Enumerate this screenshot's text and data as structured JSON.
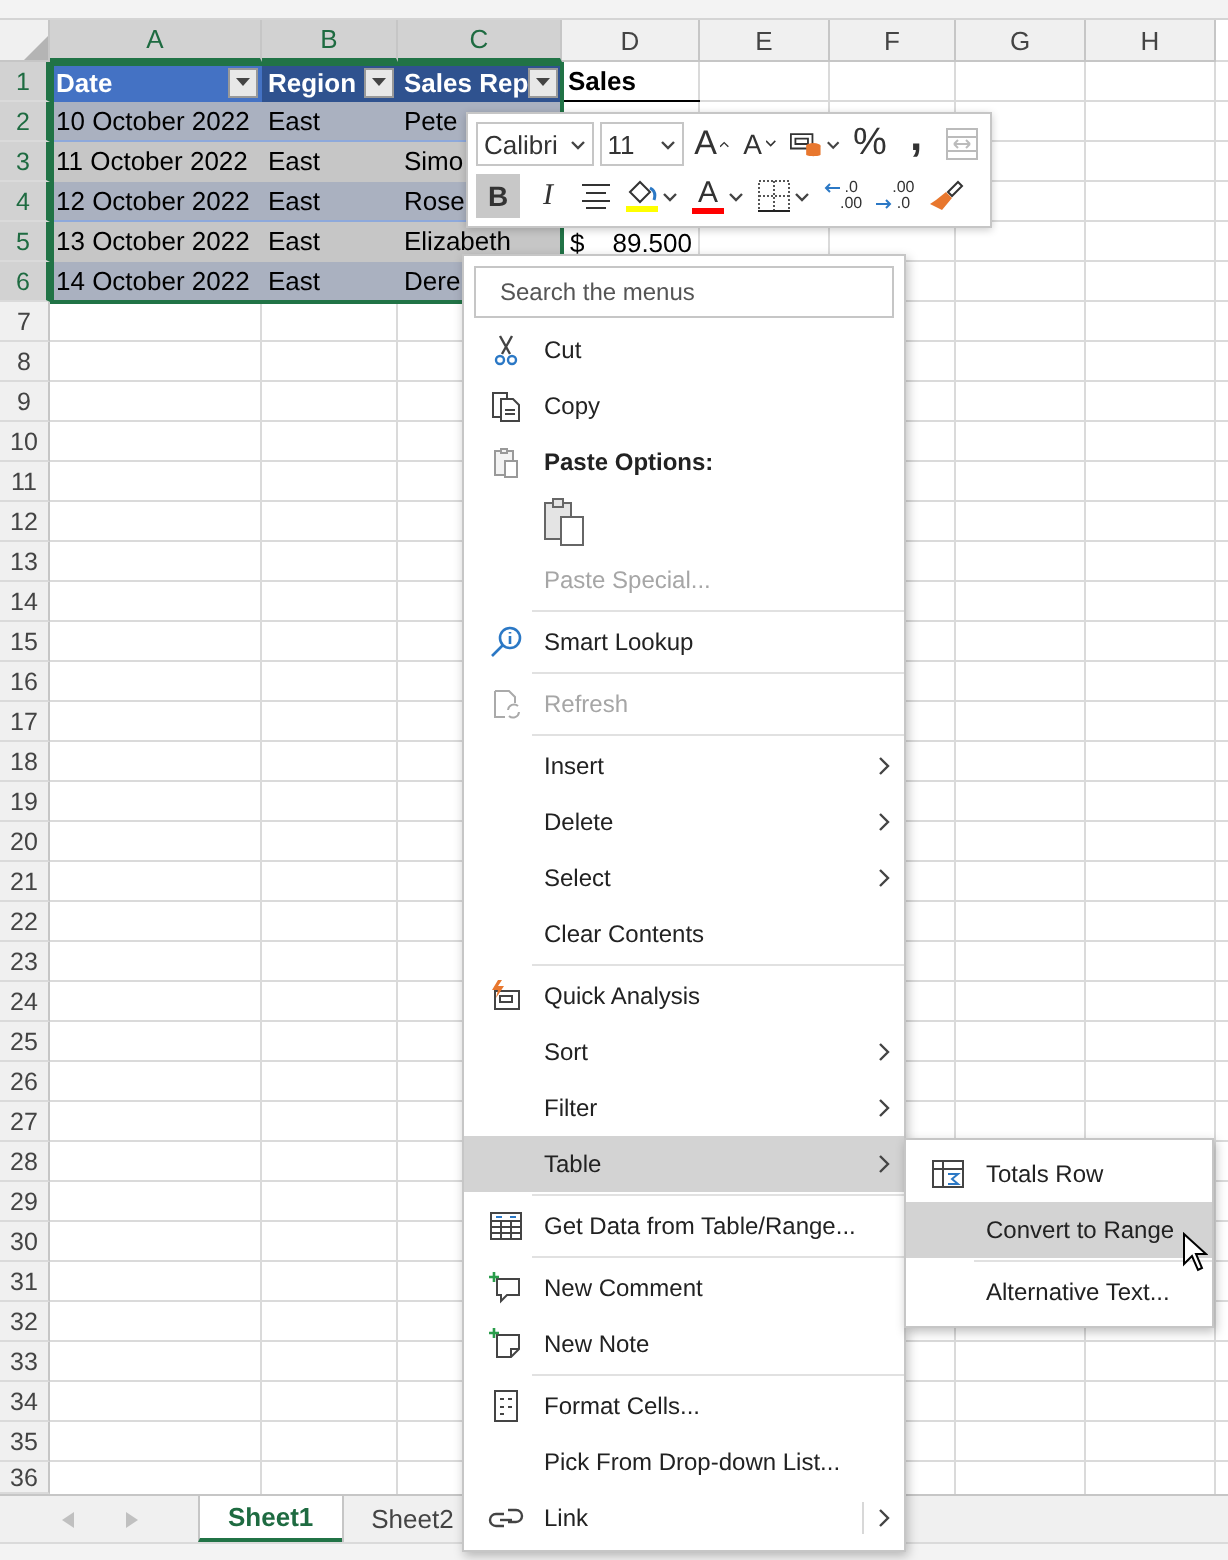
{
  "sheet": {
    "columns": [
      {
        "label": "A",
        "selected": true
      },
      {
        "label": "B",
        "selected": true
      },
      {
        "label": "C",
        "selected": true
      },
      {
        "label": "D",
        "selected": false
      },
      {
        "label": "E",
        "selected": false
      },
      {
        "label": "F",
        "selected": false
      },
      {
        "label": "G",
        "selected": false
      },
      {
        "label": "H",
        "selected": false
      }
    ],
    "row_numbers": [
      {
        "label": "1",
        "selected": true
      },
      {
        "label": "2",
        "selected": true
      },
      {
        "label": "3",
        "selected": true
      },
      {
        "label": "4",
        "selected": true
      },
      {
        "label": "5",
        "selected": true
      },
      {
        "label": "6",
        "selected": true
      },
      {
        "label": "7",
        "selected": false
      },
      {
        "label": "8",
        "selected": false
      },
      {
        "label": "9",
        "selected": false
      },
      {
        "label": "10",
        "selected": false
      },
      {
        "label": "11",
        "selected": false
      },
      {
        "label": "12",
        "selected": false
      },
      {
        "label": "13",
        "selected": false
      },
      {
        "label": "14",
        "selected": false
      },
      {
        "label": "15",
        "selected": false
      },
      {
        "label": "16",
        "selected": false
      },
      {
        "label": "17",
        "selected": false
      },
      {
        "label": "18",
        "selected": false
      },
      {
        "label": "19",
        "selected": false
      },
      {
        "label": "20",
        "selected": false
      },
      {
        "label": "21",
        "selected": false
      },
      {
        "label": "22",
        "selected": false
      },
      {
        "label": "23",
        "selected": false
      },
      {
        "label": "24",
        "selected": false
      },
      {
        "label": "25",
        "selected": false
      },
      {
        "label": "26",
        "selected": false
      },
      {
        "label": "27",
        "selected": false
      },
      {
        "label": "28",
        "selected": false
      },
      {
        "label": "29",
        "selected": false
      },
      {
        "label": "30",
        "selected": false
      },
      {
        "label": "31",
        "selected": false
      },
      {
        "label": "32",
        "selected": false
      },
      {
        "label": "33",
        "selected": false
      },
      {
        "label": "34",
        "selected": false
      },
      {
        "label": "35",
        "selected": false
      },
      {
        "label": "36",
        "selected": false
      }
    ],
    "table": {
      "selected": true,
      "headers": [
        {
          "label": "Date",
          "filter": true
        },
        {
          "label": "Region",
          "filter": true
        },
        {
          "label": "Sales Rep",
          "filter": true
        }
      ],
      "rows": [
        {
          "cells": [
            "10 October 2022",
            "East",
            "Pete"
          ]
        },
        {
          "cells": [
            "11 October 2022",
            "East",
            "Simo"
          ]
        },
        {
          "cells": [
            "12 October 2022",
            "East",
            "Rose"
          ]
        },
        {
          "cells": [
            "13 October 2022",
            "East",
            "Elizabeth"
          ],
          "sales": {
            "symbol": "$",
            "amount": "89.500"
          }
        },
        {
          "cells": [
            "14 October 2022",
            "East",
            "Dere"
          ]
        }
      ]
    },
    "column_d_header": "Sales"
  },
  "mini_toolbar": {
    "font": "Calibri",
    "size": "11",
    "row_1": [
      {
        "kind": "grow-font",
        "glyph": "A"
      },
      {
        "kind": "shrink-font",
        "glyph": "A"
      },
      {
        "kind": "cell-styles"
      },
      {
        "kind": "percent",
        "glyph": "%"
      },
      {
        "kind": "comma",
        "glyph": ","
      },
      {
        "kind": "merge",
        "disabled": true
      }
    ],
    "row_2": [
      {
        "kind": "bold",
        "glyph": "B",
        "selected": true
      },
      {
        "kind": "italic",
        "glyph": "I",
        "selected": false
      },
      {
        "kind": "center"
      },
      {
        "kind": "fill-color",
        "color": "#ffff00"
      },
      {
        "kind": "font-color",
        "glyph": "A",
        "color": "#ff0000"
      },
      {
        "kind": "borders"
      },
      {
        "kind": "increase-decimal",
        "top": ".0",
        "bottom": ".00"
      },
      {
        "kind": "decrease-decimal",
        "top": ".00",
        "bottom": ".0"
      },
      {
        "kind": "format-painter"
      }
    ]
  },
  "menu": {
    "search": {
      "placeholder": "Search the menus"
    },
    "items": [
      {
        "kind": "cut",
        "label": "Cut",
        "disabled": false,
        "selected": false,
        "submenu": false,
        "separator_before": false
      },
      {
        "kind": "copy",
        "label": "Copy",
        "disabled": false,
        "selected": false,
        "submenu": false,
        "separator_before": false
      },
      {
        "kind": "paste-header",
        "label": "Paste Options:",
        "disabled": false,
        "selected": false,
        "submenu": false,
        "separator_before": false
      },
      {
        "kind": "paste-options",
        "disabled": false,
        "separator_before": false
      },
      {
        "kind": "plain",
        "label": "Paste Special...",
        "disabled": true,
        "selected": false,
        "submenu": false,
        "separator_before": false
      },
      {
        "kind": "lookup",
        "label": "Smart Lookup",
        "disabled": false,
        "selected": false,
        "submenu": false,
        "separator_before": true
      },
      {
        "kind": "refresh",
        "label": "Refresh",
        "disabled": true,
        "selected": false,
        "submenu": false,
        "separator_before": true
      },
      {
        "kind": "plain",
        "label": "Insert",
        "disabled": false,
        "selected": false,
        "submenu": true,
        "separator_before": true
      },
      {
        "kind": "plain",
        "label": "Delete",
        "disabled": false,
        "selected": false,
        "submenu": true,
        "separator_before": false
      },
      {
        "kind": "plain",
        "label": "Select",
        "disabled": false,
        "selected": false,
        "submenu": true,
        "separator_before": false
      },
      {
        "kind": "plain",
        "label": "Clear Contents",
        "disabled": false,
        "selected": false,
        "submenu": false,
        "separator_before": false
      },
      {
        "kind": "quick-analysis",
        "label": "Quick Analysis",
        "disabled": false,
        "selected": false,
        "submenu": false,
        "separator_before": true
      },
      {
        "kind": "plain",
        "label": "Sort",
        "disabled": false,
        "selected": false,
        "submenu": true,
        "separator_before": false
      },
      {
        "kind": "plain",
        "label": "Filter",
        "disabled": false,
        "selected": false,
        "submenu": true,
        "separator_before": false
      },
      {
        "kind": "plain",
        "label": "Table",
        "disabled": false,
        "selected": true,
        "submenu": true,
        "separator_before": false
      },
      {
        "kind": "get-data",
        "label": "Get Data from Table/Range...",
        "disabled": false,
        "selected": false,
        "submenu": false,
        "separator_before": true
      },
      {
        "kind": "new-comment",
        "label": "New Comment",
        "disabled": false,
        "selected": false,
        "submenu": false,
        "separator_before": true
      },
      {
        "kind": "new-note",
        "label": "New Note",
        "disabled": false,
        "selected": false,
        "submenu": false,
        "separator_before": false
      },
      {
        "kind": "format-cells",
        "label": "Format Cells...",
        "disabled": false,
        "selected": false,
        "submenu": false,
        "separator_before": true
      },
      {
        "kind": "plain",
        "label": "Pick From Drop-down List...",
        "disabled": false,
        "selected": false,
        "submenu": false,
        "separator_before": false
      },
      {
        "kind": "link",
        "label": "Link",
        "disabled": false,
        "selected": false,
        "submenu": true,
        "separator_before": false
      }
    ]
  },
  "submenu": {
    "items": [
      {
        "kind": "totals-row",
        "label": "Totals Row",
        "selected": false,
        "separator_before": false
      },
      {
        "kind": "plain",
        "label": "Convert to Range",
        "selected": true,
        "separator_before": false
      },
      {
        "kind": "plain",
        "label": "Alternative Text...",
        "selected": false,
        "separator_before": true
      }
    ]
  },
  "sheet_tabs": [
    {
      "label": "Sheet1",
      "selected": true
    },
    {
      "label": "Sheet2",
      "selected": false
    }
  ]
}
